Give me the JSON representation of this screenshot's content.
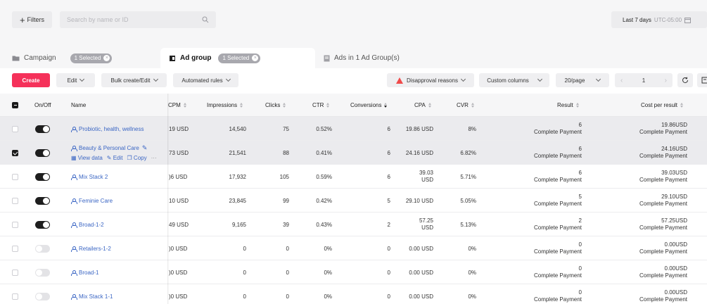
{
  "topbar": {
    "filters_label": "Filters",
    "search_placeholder": "Search by name or ID",
    "date_range": "Last 7 days",
    "timezone": "UTC-05:00"
  },
  "level_tabs": [
    {
      "label": "Campaign",
      "badge": "1 Selected"
    },
    {
      "label": "Ad group",
      "badge": "1 Selected"
    },
    {
      "label": "Ads in 1 Ad Group(s)"
    }
  ],
  "toolbar": {
    "create": "Create",
    "edit": "Edit",
    "bulk": "Bulk create/Edit",
    "automated": "Automated rules",
    "disapproval": "Disapproval reasons",
    "custom_columns": "Custom columns",
    "per_page": "20/page",
    "page": "1"
  },
  "columns": {
    "onoff": "On/Off",
    "name": "Name",
    "cpm": "CPM",
    "impressions": "Impressions",
    "clicks": "Clicks",
    "ctr": "CTR",
    "conversions": "Conversions",
    "cpa": "CPA",
    "cvr": "CVR",
    "result": "Result",
    "cost_per_result": "Cost per result"
  },
  "rows": [
    {
      "checked": false,
      "on": true,
      "name": "Probiotic, health, wellness",
      "cpm": "19 USD",
      "impressions": "14,540",
      "clicks": "75",
      "ctr": "0.52%",
      "conversions": "6",
      "cpa": "19.86 USD",
      "cvr": "8%",
      "result": "6",
      "result_sub": "Complete Payment",
      "cpr": "19.86USD",
      "cpr_sub": "Complete Payment"
    },
    {
      "checked": true,
      "on": true,
      "name": "Beauty & Personal Care",
      "view_data": "View data",
      "edit": "Edit",
      "copy": "Copy",
      "cpm": "73 USD",
      "impressions": "21,541",
      "clicks": "88",
      "ctr": "0.41%",
      "conversions": "6",
      "cpa": "24.16 USD",
      "cvr": "6.82%",
      "result": "6",
      "result_sub": "Complete Payment",
      "cpr": "24.16USD",
      "cpr_sub": "Complete Payment"
    },
    {
      "checked": false,
      "on": true,
      "name": "Mix Stack 2",
      "cpm": ")6 USD",
      "impressions": "17,932",
      "clicks": "105",
      "ctr": "0.59%",
      "conversions": "6",
      "cpa": "39.03",
      "cpa_unit": "USD",
      "cvr": "5.71%",
      "result": "6",
      "result_sub": "Complete Payment",
      "cpr": "39.03USD",
      "cpr_sub": "Complete Payment"
    },
    {
      "checked": false,
      "on": true,
      "name": "Feminie Care",
      "cpm": "10 USD",
      "impressions": "23,845",
      "clicks": "99",
      "ctr": "0.42%",
      "conversions": "5",
      "cpa": "29.10 USD",
      "cvr": "5.05%",
      "result": "5",
      "result_sub": "Complete Payment",
      "cpr": "29.10USD",
      "cpr_sub": "Complete Payment"
    },
    {
      "checked": false,
      "on": true,
      "name": "Broad-1-2",
      "cpm": "49 USD",
      "impressions": "9,165",
      "clicks": "39",
      "ctr": "0.43%",
      "conversions": "2",
      "cpa": "57.25",
      "cpa_unit": "USD",
      "cvr": "5.13%",
      "result": "2",
      "result_sub": "Complete Payment",
      "cpr": "57.25USD",
      "cpr_sub": "Complete Payment"
    },
    {
      "checked": false,
      "on": false,
      "name": "Retailers-1-2",
      "cpm": ")0 USD",
      "impressions": "0",
      "clicks": "0",
      "ctr": "0%",
      "conversions": "0",
      "cpa": "0.00 USD",
      "cvr": "0%",
      "result": "0",
      "result_sub": "Complete Payment",
      "cpr": "0.00USD",
      "cpr_sub": "Complete Payment"
    },
    {
      "checked": false,
      "on": false,
      "name": "Broad-1",
      "cpm": ")0 USD",
      "impressions": "0",
      "clicks": "0",
      "ctr": "0%",
      "conversions": "0",
      "cpa": "0.00 USD",
      "cvr": "0%",
      "result": "0",
      "result_sub": "Complete Payment",
      "cpr": "0.00USD",
      "cpr_sub": "Complete Payment"
    },
    {
      "checked": false,
      "on": false,
      "name": "Mix Stack 1-1",
      "cpm": ")0 USD",
      "impressions": "0",
      "clicks": "0",
      "ctr": "0%",
      "conversions": "0",
      "cpa": "0.00 USD",
      "cvr": "0%",
      "result": "0",
      "result_sub": "Complete Payment",
      "cpr": "0.00USD",
      "cpr_sub": "Complete Payment"
    }
  ]
}
